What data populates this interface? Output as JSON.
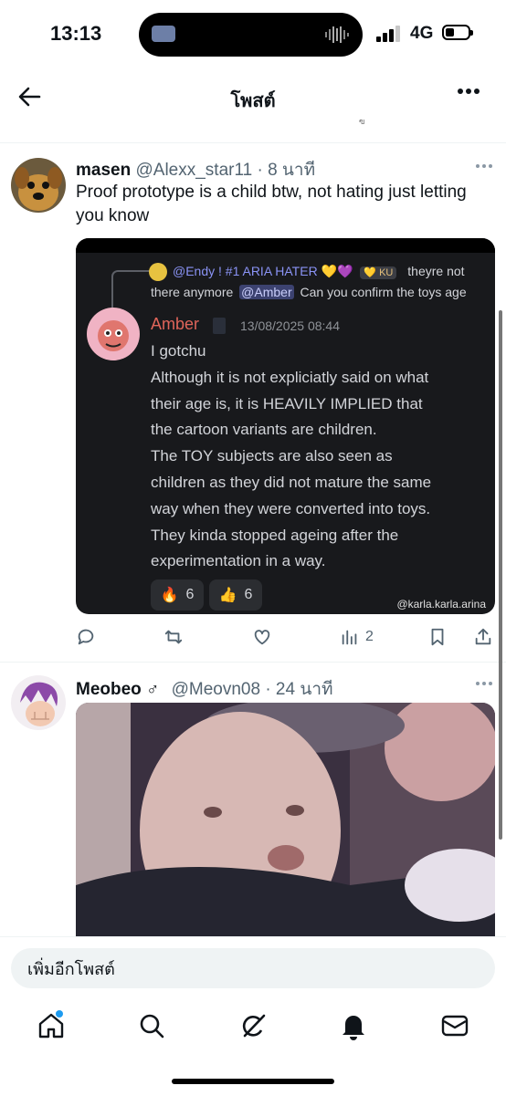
{
  "status": {
    "time": "13:13",
    "network": "4G",
    "battery_level": 0.4
  },
  "nav": {
    "title": "โพสต์",
    "tiny_mark": "ฃ"
  },
  "tweets": [
    {
      "name": "masen",
      "handle": "@Alexx_star11",
      "time": "· 8 นาที",
      "text": "Proof prototype is a child btw, not hating just letting you know",
      "media": {
        "reply_to": "@Endy ! #1 ARIA HATER 💛💜",
        "reply_badge": "💛 KU",
        "reply_text_1": "theyre not",
        "reply_text_2": "there anymore",
        "reply_mention": "@Amber",
        "reply_text_3": "Can you confirm the toys age",
        "author": "Amber",
        "timestamp": "13/08/2025 08:44",
        "lines": [
          "I gotchu",
          "Although it is not expliciatly said on what",
          "their age is, it is HEAVILY IMPLIED that",
          "the cartoon variants are children.",
          "The TOY subjects are also seen as",
          "children as they did not mature the same",
          "way when they were converted into toys.",
          "They kinda stopped ageing after the",
          "experimentation in a way."
        ],
        "reactions": [
          {
            "emoji": "🔥",
            "count": "6"
          },
          {
            "emoji": "👍",
            "count": "6"
          }
        ],
        "watermark": "@karla.karla.arina"
      },
      "views": "2"
    },
    {
      "name": "Meobeo",
      "gender": "♂",
      "handle": "@Meovn08",
      "time": "· 24 นาที"
    }
  ],
  "composer": {
    "placeholder": "เพิ่มอีกโพสต์"
  },
  "tabs": [
    "home-icon",
    "search-icon",
    "grok-icon",
    "notifications-icon",
    "messages-icon"
  ],
  "colors": {
    "accent": "#1d9bf0",
    "muted": "#536471",
    "amber_name": "#e0655a",
    "mention_bg": "#3c4270",
    "mention_fg": "#c9cdfb"
  }
}
